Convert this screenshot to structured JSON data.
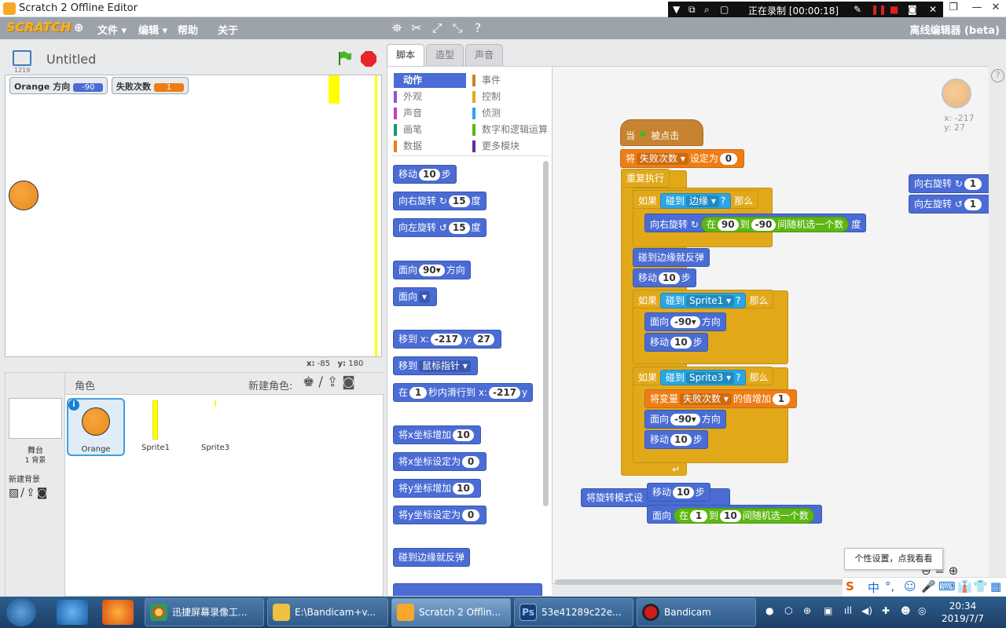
{
  "window": {
    "title": "Scratch 2 Offline Editor",
    "controls": [
      "❐",
      "—",
      "✕"
    ]
  },
  "recorder": {
    "status": "正在录制 [00:00:18]"
  },
  "menubar": {
    "logo": "SCRATCH",
    "menus": [
      "文件 ▾",
      "编辑 ▾",
      "帮助",
      "关于"
    ],
    "offline_label": "离线编辑器 (beta)"
  },
  "stage": {
    "version": "1219",
    "project_title": "Untitled",
    "monitors": [
      {
        "label": "Orange 方向",
        "value": "-90",
        "color": "#4a6cd4"
      },
      {
        "label": "失败次数",
        "value": "1",
        "color": "#ee7d16"
      }
    ],
    "mouse_x_label": "x:",
    "mouse_x": "-85",
    "mouse_y_label": "y:",
    "mouse_y": "180"
  },
  "sprites_pane": {
    "title": "角色",
    "new_sprite_label": "新建角色:",
    "stage_label": "舞台",
    "backdrop_count": "1 背景",
    "new_backdrop_label": "新建背景",
    "sprites": [
      {
        "name": "Orange",
        "selected": true
      },
      {
        "name": "Sprite1",
        "selected": false
      },
      {
        "name": "Sprite3",
        "selected": false
      }
    ]
  },
  "tabs": [
    "脚本",
    "造型",
    "声音"
  ],
  "palette": {
    "categories_left": [
      {
        "label": "动作",
        "color": "#4a6cd4",
        "selected": true
      },
      {
        "label": "外观",
        "color": "#8a55d7"
      },
      {
        "label": "声音",
        "color": "#bb42c3"
      },
      {
        "label": "画笔",
        "color": "#0e9a6c"
      },
      {
        "label": "数据",
        "color": "#ee7d16"
      }
    ],
    "categories_right": [
      {
        "label": "事件",
        "color": "#c88330"
      },
      {
        "label": "控制",
        "color": "#e1a91a"
      },
      {
        "label": "侦测",
        "color": "#2ca5e2"
      },
      {
        "label": "数字和逻辑运算",
        "color": "#5cb712"
      },
      {
        "label": "更多模块",
        "color": "#632d99"
      }
    ],
    "blocks": {
      "move": [
        "移动",
        "10",
        "步"
      ],
      "turn_right": [
        "向右旋转 ↻",
        "15",
        "度"
      ],
      "turn_left": [
        "向左旋转 ↺",
        "15",
        "度"
      ],
      "point_dir": [
        "面向",
        "90▾",
        "方向"
      ],
      "point_towards": [
        "面向",
        "▾"
      ],
      "goto_xy": [
        "移到 x:",
        "-217",
        "y:",
        "27"
      ],
      "goto": [
        "移到",
        "鼠标指针 ▾"
      ],
      "glide": [
        "在",
        "1",
        "秒内滑行到 x:",
        "-217",
        "y"
      ],
      "change_x": [
        "将x坐标增加",
        "10"
      ],
      "set_x": [
        "将x坐标设定为",
        "0"
      ],
      "change_y": [
        "将y坐标增加",
        "10"
      ],
      "set_y": [
        "将y坐标设定为",
        "0"
      ],
      "bounce": "碰到边缘就反弹"
    }
  },
  "script": {
    "sprite_x": "x: -217",
    "sprite_y": "y: 27",
    "hat": [
      "当",
      "被点击"
    ],
    "set_var": [
      "将",
      "失败次数 ▾",
      "设定为",
      "0"
    ],
    "forever": "重复执行",
    "if1": [
      "如果",
      "碰到",
      "边缘 ▾",
      "?",
      "那么"
    ],
    "turn_random": [
      "向右旋转 ↻",
      "在",
      "90",
      "到",
      "-90",
      "间随机选一个数",
      "度"
    ],
    "bounce": "碰到边缘就反弹",
    "move1": [
      "移动",
      "10",
      "步"
    ],
    "if2": [
      "如果",
      "碰到",
      "Sprite1 ▾",
      "?",
      "那么"
    ],
    "face1": [
      "面向",
      "-90▾",
      "方向"
    ],
    "move2": [
      "移动",
      "10",
      "步"
    ],
    "if3": [
      "如果",
      "碰到",
      "Sprite3 ▾",
      "?",
      "那么"
    ],
    "change_var": [
      "将变量",
      "失败次数 ▾",
      "的值增加",
      "1"
    ],
    "face2": [
      "面向",
      "-90▾",
      "方向"
    ],
    "move3": [
      "移动",
      "10",
      "步"
    ],
    "loose1": [
      "将旋转模式设",
      "移动",
      "10",
      "步"
    ],
    "loose2": [
      "面向",
      "在",
      "1",
      "到",
      "10",
      "间随机选一个数"
    ],
    "side1": [
      "向右旋转 ↻",
      "1"
    ],
    "side2": [
      "向左旋转 ↺",
      "1"
    ]
  },
  "tooltip": "个性设置，点我看看",
  "ime": [
    "S",
    "中",
    "°,",
    "☺",
    "🎤",
    "⌨",
    "👔",
    "👕",
    "▦"
  ],
  "taskbar": {
    "tasks": [
      {
        "label": "迅捷屏幕录像工...",
        "color": "#e04a2a"
      },
      {
        "label": "E:\\Bandicam+v...",
        "color": "#f0c040"
      },
      {
        "label": "Scratch 2 Offlin...",
        "color": "#f7a82a",
        "active": true
      },
      {
        "label": "53e41289c22e...",
        "color": "#1d3b6e"
      },
      {
        "label": "Bandicam",
        "color": "#d01c1c"
      }
    ],
    "time": "20:34",
    "date": "2019/7/7"
  }
}
